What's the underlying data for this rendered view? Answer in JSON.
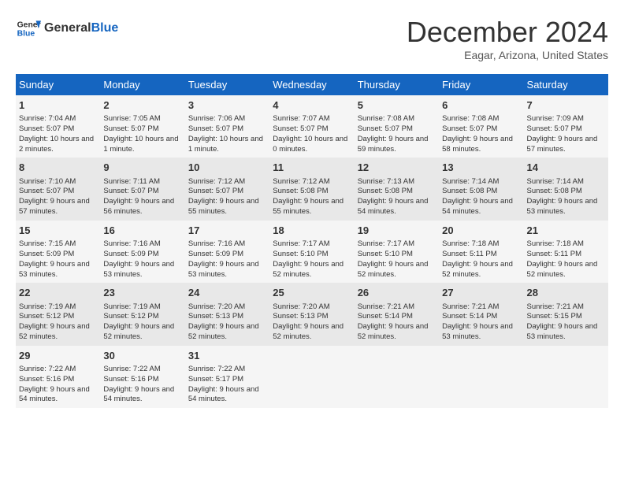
{
  "header": {
    "logo_line1": "General",
    "logo_line2": "Blue",
    "month_title": "December 2024",
    "location": "Eagar, Arizona, United States"
  },
  "weekdays": [
    "Sunday",
    "Monday",
    "Tuesday",
    "Wednesday",
    "Thursday",
    "Friday",
    "Saturday"
  ],
  "weeks": [
    [
      {
        "day": "1",
        "rise": "7:04 AM",
        "set": "5:07 PM",
        "daylight": "10 hours and 2 minutes."
      },
      {
        "day": "2",
        "rise": "7:05 AM",
        "set": "5:07 PM",
        "daylight": "10 hours and 1 minute."
      },
      {
        "day": "3",
        "rise": "7:06 AM",
        "set": "5:07 PM",
        "daylight": "10 hours and 1 minute."
      },
      {
        "day": "4",
        "rise": "7:07 AM",
        "set": "5:07 PM",
        "daylight": "10 hours and 0 minutes."
      },
      {
        "day": "5",
        "rise": "7:08 AM",
        "set": "5:07 PM",
        "daylight": "9 hours and 59 minutes."
      },
      {
        "day": "6",
        "rise": "7:08 AM",
        "set": "5:07 PM",
        "daylight": "9 hours and 58 minutes."
      },
      {
        "day": "7",
        "rise": "7:09 AM",
        "set": "5:07 PM",
        "daylight": "9 hours and 57 minutes."
      }
    ],
    [
      {
        "day": "8",
        "rise": "7:10 AM",
        "set": "5:07 PM",
        "daylight": "9 hours and 57 minutes."
      },
      {
        "day": "9",
        "rise": "7:11 AM",
        "set": "5:07 PM",
        "daylight": "9 hours and 56 minutes."
      },
      {
        "day": "10",
        "rise": "7:12 AM",
        "set": "5:07 PM",
        "daylight": "9 hours and 55 minutes."
      },
      {
        "day": "11",
        "rise": "7:12 AM",
        "set": "5:08 PM",
        "daylight": "9 hours and 55 minutes."
      },
      {
        "day": "12",
        "rise": "7:13 AM",
        "set": "5:08 PM",
        "daylight": "9 hours and 54 minutes."
      },
      {
        "day": "13",
        "rise": "7:14 AM",
        "set": "5:08 PM",
        "daylight": "9 hours and 54 minutes."
      },
      {
        "day": "14",
        "rise": "7:14 AM",
        "set": "5:08 PM",
        "daylight": "9 hours and 53 minutes."
      }
    ],
    [
      {
        "day": "15",
        "rise": "7:15 AM",
        "set": "5:09 PM",
        "daylight": "9 hours and 53 minutes."
      },
      {
        "day": "16",
        "rise": "7:16 AM",
        "set": "5:09 PM",
        "daylight": "9 hours and 53 minutes."
      },
      {
        "day": "17",
        "rise": "7:16 AM",
        "set": "5:09 PM",
        "daylight": "9 hours and 53 minutes."
      },
      {
        "day": "18",
        "rise": "7:17 AM",
        "set": "5:10 PM",
        "daylight": "9 hours and 52 minutes."
      },
      {
        "day": "19",
        "rise": "7:17 AM",
        "set": "5:10 PM",
        "daylight": "9 hours and 52 minutes."
      },
      {
        "day": "20",
        "rise": "7:18 AM",
        "set": "5:11 PM",
        "daylight": "9 hours and 52 minutes."
      },
      {
        "day": "21",
        "rise": "7:18 AM",
        "set": "5:11 PM",
        "daylight": "9 hours and 52 minutes."
      }
    ],
    [
      {
        "day": "22",
        "rise": "7:19 AM",
        "set": "5:12 PM",
        "daylight": "9 hours and 52 minutes."
      },
      {
        "day": "23",
        "rise": "7:19 AM",
        "set": "5:12 PM",
        "daylight": "9 hours and 52 minutes."
      },
      {
        "day": "24",
        "rise": "7:20 AM",
        "set": "5:13 PM",
        "daylight": "9 hours and 52 minutes."
      },
      {
        "day": "25",
        "rise": "7:20 AM",
        "set": "5:13 PM",
        "daylight": "9 hours and 52 minutes."
      },
      {
        "day": "26",
        "rise": "7:21 AM",
        "set": "5:14 PM",
        "daylight": "9 hours and 52 minutes."
      },
      {
        "day": "27",
        "rise": "7:21 AM",
        "set": "5:14 PM",
        "daylight": "9 hours and 53 minutes."
      },
      {
        "day": "28",
        "rise": "7:21 AM",
        "set": "5:15 PM",
        "daylight": "9 hours and 53 minutes."
      }
    ],
    [
      {
        "day": "29",
        "rise": "7:22 AM",
        "set": "5:16 PM",
        "daylight": "9 hours and 54 minutes."
      },
      {
        "day": "30",
        "rise": "7:22 AM",
        "set": "5:16 PM",
        "daylight": "9 hours and 54 minutes."
      },
      {
        "day": "31",
        "rise": "7:22 AM",
        "set": "5:17 PM",
        "daylight": "9 hours and 54 minutes."
      },
      null,
      null,
      null,
      null
    ]
  ],
  "labels": {
    "sunrise": "Sunrise:",
    "sunset": "Sunset:",
    "daylight": "Daylight:"
  }
}
